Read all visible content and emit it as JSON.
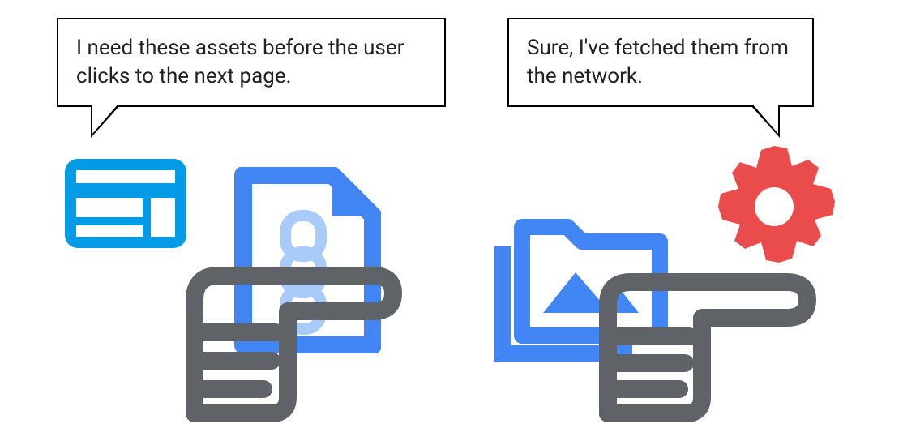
{
  "speech": {
    "left": "I need these assets before the user clicks to the next page.",
    "right": "Sure, I've fetched them from the network."
  },
  "colors": {
    "brightBlue": "#039be5",
    "mediumBlue": "#4285f4",
    "darkBlue": "#1a73e8",
    "red": "#ea4c4c",
    "gray": "#5f6368",
    "lightBlue": "#a8cbfa"
  },
  "icons": {
    "browserWindow": "browser-window-icon",
    "document": "document-chain-icon",
    "handLeft": "hand-pointing-icon",
    "imagesFolder": "images-folder-icon",
    "gear": "gear-icon",
    "handRight": "hand-pointing-icon"
  }
}
